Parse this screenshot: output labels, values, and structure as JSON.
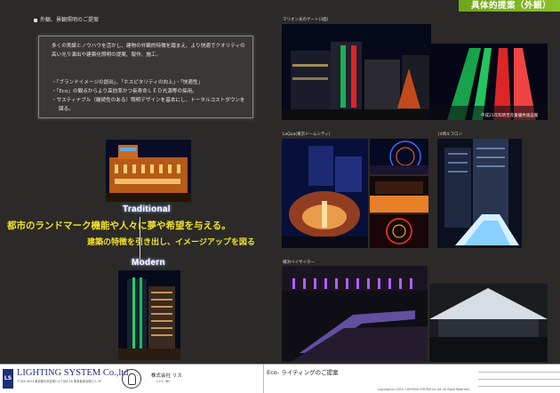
{
  "header": {
    "title": "具体的提案（外観）"
  },
  "section_label": "外観、景観照明のご提案",
  "description": {
    "intro": "多くの実績とノウハウを活かし、建物の外観的特徴を踏まえ、より快適でクオリティの高い光り演出や建築化照明の提案、製作、施工。",
    "bullets": [
      "「ブランドイメージの創出」、「ホスピタリティの向上」・「快適性」",
      "「Eco」の観点からより高効率かつ長寿命ＬＥＤ光源等の採用。",
      "サスティナブル（継続性のある）照明デザインを基本にし、トータルコストダウンを図る。"
    ]
  },
  "photo_captions": {
    "top_right": "マリオン光のゲート(3面)",
    "top_right_inner": "平成21年照明普及賞優秀施設賞",
    "mid_left": "LaQua(東京ドームシティ)",
    "mid_right": "川崎ルフロン",
    "bottom": "横浜ベイサイター"
  },
  "labels": {
    "traditional": "Traditional",
    "modern": "Modern"
  },
  "headlines": {
    "line1": "都市のランドマーク機能や人々に夢や希望を与える。",
    "line2": "建築の特徴を引き出し、イメージアップを図る"
  },
  "footer": {
    "logo_mark": "LS",
    "logo_text": "LIGHTING SYSTEM Co.,ltd",
    "logo_sub": "〒104-0033 東京都中央区新川2丁目6-16 馬事畜産会館ビル 5F",
    "company": "株式会社 リス",
    "company_sub": "L.I.S. INC.",
    "doc_title": "Eco- ライティングのご提案",
    "copyright": "Copyright(c) 2010, LIGHTING SYSTEM Co.,ltd. All Right Reserved."
  },
  "colors": {
    "accent_green": "#8dc12a",
    "headline_yellow": "#f1e02a",
    "background": "#2b2a28"
  }
}
